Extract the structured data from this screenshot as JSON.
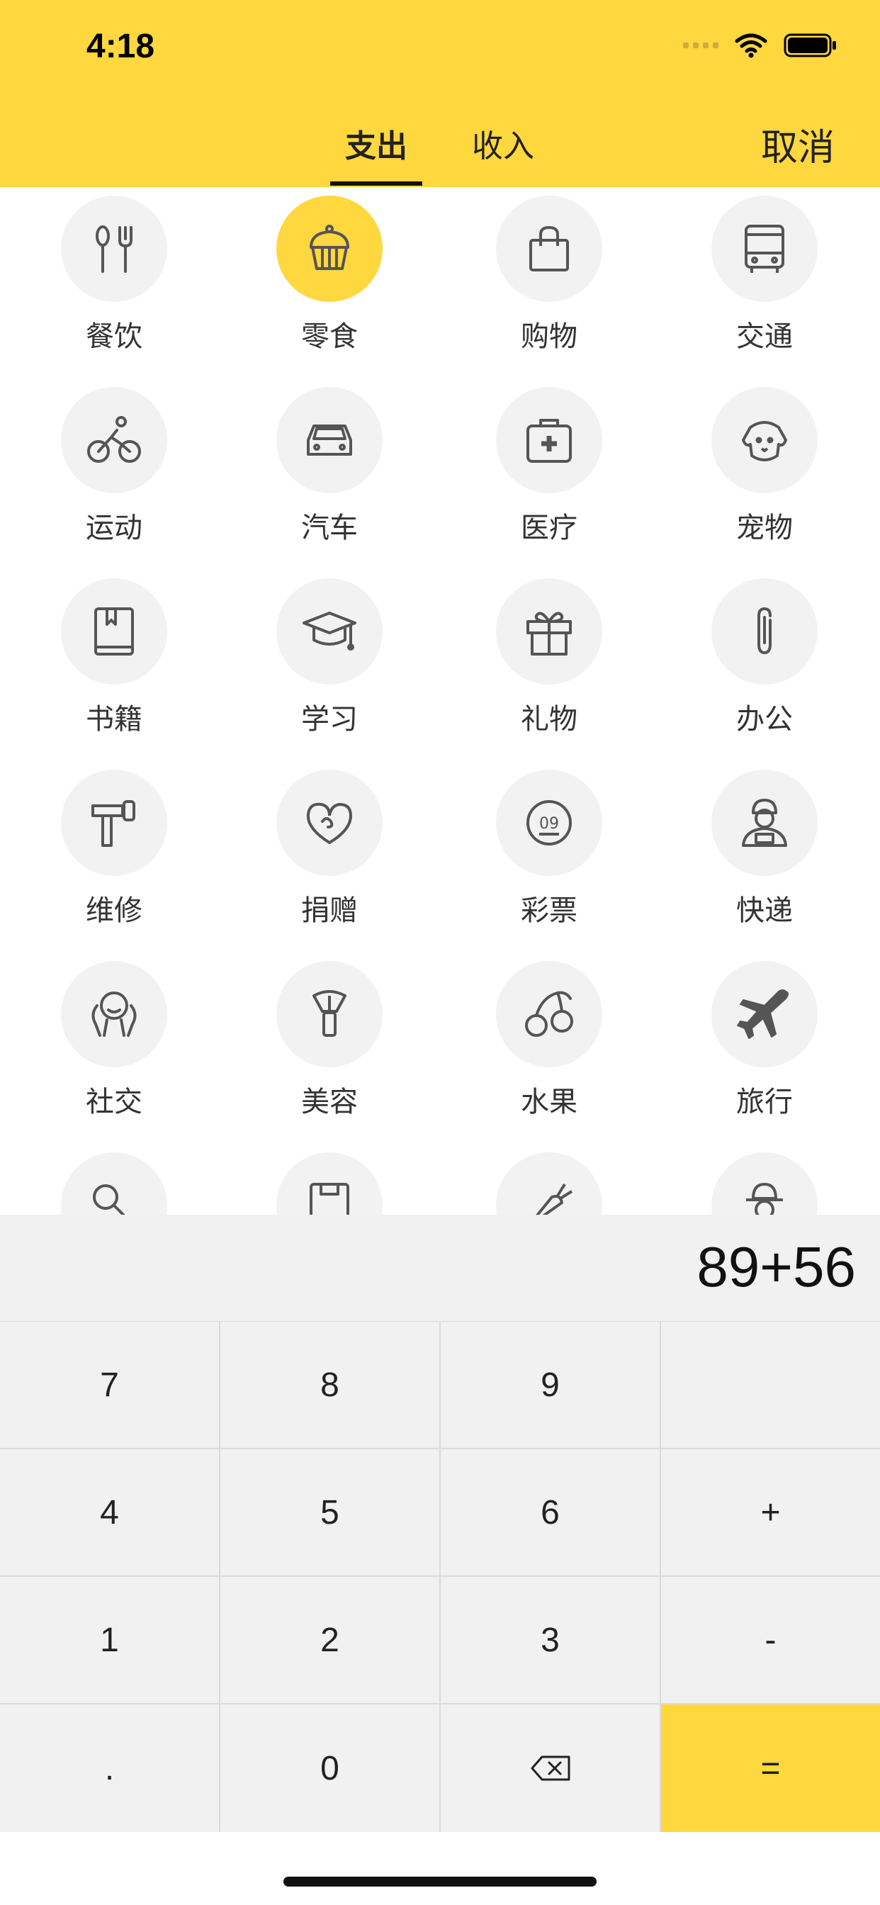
{
  "status_bar": {
    "time": "4:18"
  },
  "header": {
    "tabs": [
      {
        "label": "支出"
      },
      {
        "label": "收入"
      }
    ],
    "cancel_label": "取消",
    "accent_color": "#FFD73F"
  },
  "categories": [
    {
      "label": "餐饮",
      "icon": "utensils-icon"
    },
    {
      "label": "零食",
      "icon": "cupcake-icon",
      "selected": true
    },
    {
      "label": "购物",
      "icon": "shopping-bag-icon"
    },
    {
      "label": "交通",
      "icon": "bus-icon"
    },
    {
      "label": "运动",
      "icon": "cyclist-icon"
    },
    {
      "label": "汽车",
      "icon": "car-icon"
    },
    {
      "label": "医疗",
      "icon": "medical-kit-icon"
    },
    {
      "label": "宠物",
      "icon": "dog-icon"
    },
    {
      "label": "书籍",
      "icon": "book-icon"
    },
    {
      "label": "学习",
      "icon": "graduation-cap-icon"
    },
    {
      "label": "礼物",
      "icon": "gift-icon"
    },
    {
      "label": "办公",
      "icon": "paperclip-icon"
    },
    {
      "label": "维修",
      "icon": "hammer-icon"
    },
    {
      "label": "捐赠",
      "icon": "heart-icon"
    },
    {
      "label": "彩票",
      "icon": "lottery-ball-icon"
    },
    {
      "label": "快递",
      "icon": "courier-icon"
    },
    {
      "label": "社交",
      "icon": "people-icon"
    },
    {
      "label": "美容",
      "icon": "makeup-brush-icon"
    },
    {
      "label": "水果",
      "icon": "cherry-icon"
    },
    {
      "label": "旅行",
      "icon": "airplane-icon"
    }
  ],
  "keypad": {
    "display": "89+56",
    "keys": [
      "7",
      "8",
      "9",
      "",
      "4",
      "5",
      "6",
      "+",
      "1",
      "2",
      "3",
      "-",
      ".",
      "0",
      "⌫",
      "="
    ]
  }
}
